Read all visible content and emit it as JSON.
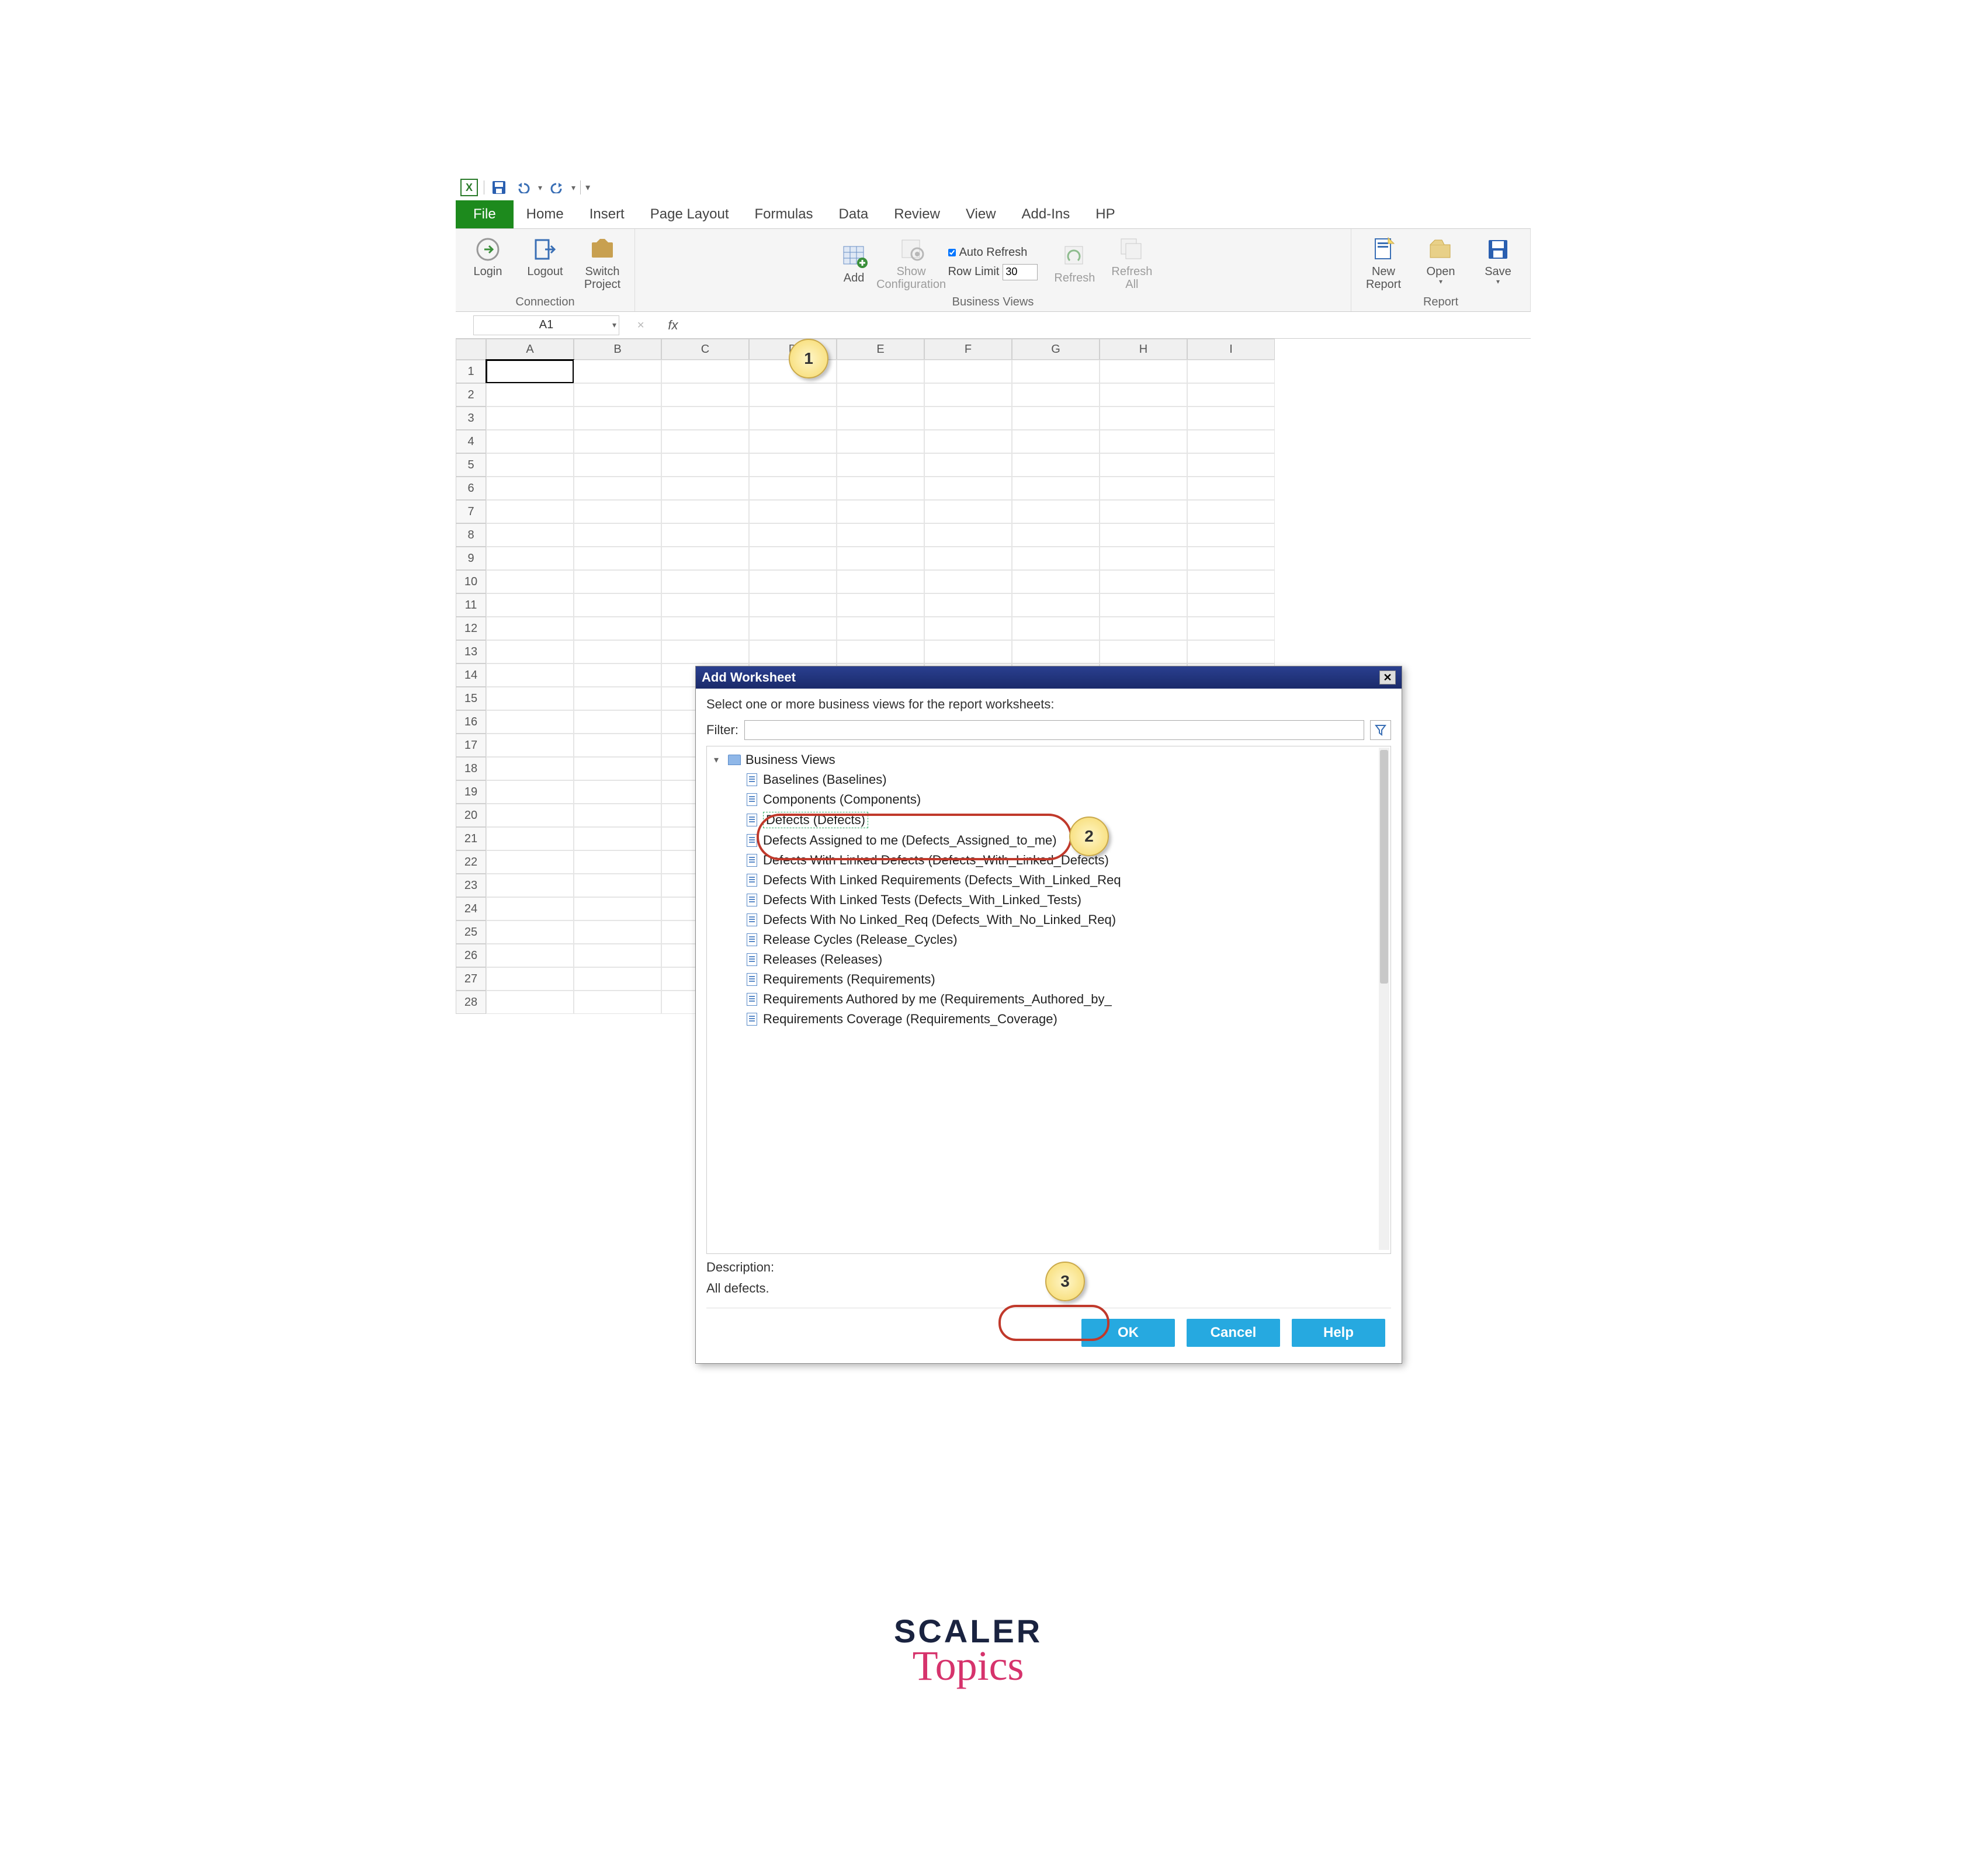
{
  "qat": {
    "app": "X"
  },
  "tabs": [
    "File",
    "Home",
    "Insert",
    "Page Layout",
    "Formulas",
    "Data",
    "Review",
    "View",
    "Add-Ins",
    "HP"
  ],
  "ribbon": {
    "connection": {
      "label": "Connection",
      "login": "Login",
      "logout": "Logout",
      "switch": "Switch Project"
    },
    "bv": {
      "label": "Business Views",
      "add": "Add",
      "showcfg": "Show Configuration",
      "autorefresh": "Auto Refresh",
      "rowlimit_label": "Row Limit",
      "rowlimit_value": "30",
      "refresh": "Refresh",
      "refresh_all": "Refresh All"
    },
    "report": {
      "label": "Report",
      "new": "New Report",
      "open": "Open",
      "save": "Save"
    }
  },
  "namebox": "A1",
  "fx": "fx",
  "columns": [
    "A",
    "B",
    "C",
    "D",
    "E",
    "F",
    "G",
    "H",
    "I"
  ],
  "rows": [
    1,
    2,
    3,
    4,
    5,
    6,
    7,
    8,
    9,
    10,
    11,
    12,
    13,
    14,
    15,
    16,
    17,
    18,
    19,
    20,
    21,
    22,
    23,
    24,
    25,
    26,
    27,
    28
  ],
  "dialog": {
    "title": "Add Worksheet",
    "instruction": "Select one or more business views for the report worksheets:",
    "filter_label": "Filter:",
    "root": "Business Views",
    "items": [
      "Baselines (Baselines)",
      "Components (Components)",
      "Defects (Defects)",
      "Defects Assigned to me (Defects_Assigned_to_me)",
      "Defects With Linked Defects (Defects_With_Linked_Defects)",
      "Defects With Linked Requirements (Defects_With_Linked_Req",
      "Defects With Linked Tests (Defects_With_Linked_Tests)",
      "Defects With No Linked_Req (Defects_With_No_Linked_Req)",
      "Release Cycles (Release_Cycles)",
      "Releases (Releases)",
      "Requirements (Requirements)",
      "Requirements Authored by me (Requirements_Authored_by_",
      "Requirements Coverage (Requirements_Coverage)"
    ],
    "selected_index": 2,
    "desc_label": "Description:",
    "desc_text": "All defects.",
    "ok": "OK",
    "cancel": "Cancel",
    "help": "Help"
  },
  "callouts": {
    "c1": "1",
    "c2": "2",
    "c3": "3"
  },
  "brand": {
    "l1": "SCALER",
    "l2": "Topics"
  }
}
